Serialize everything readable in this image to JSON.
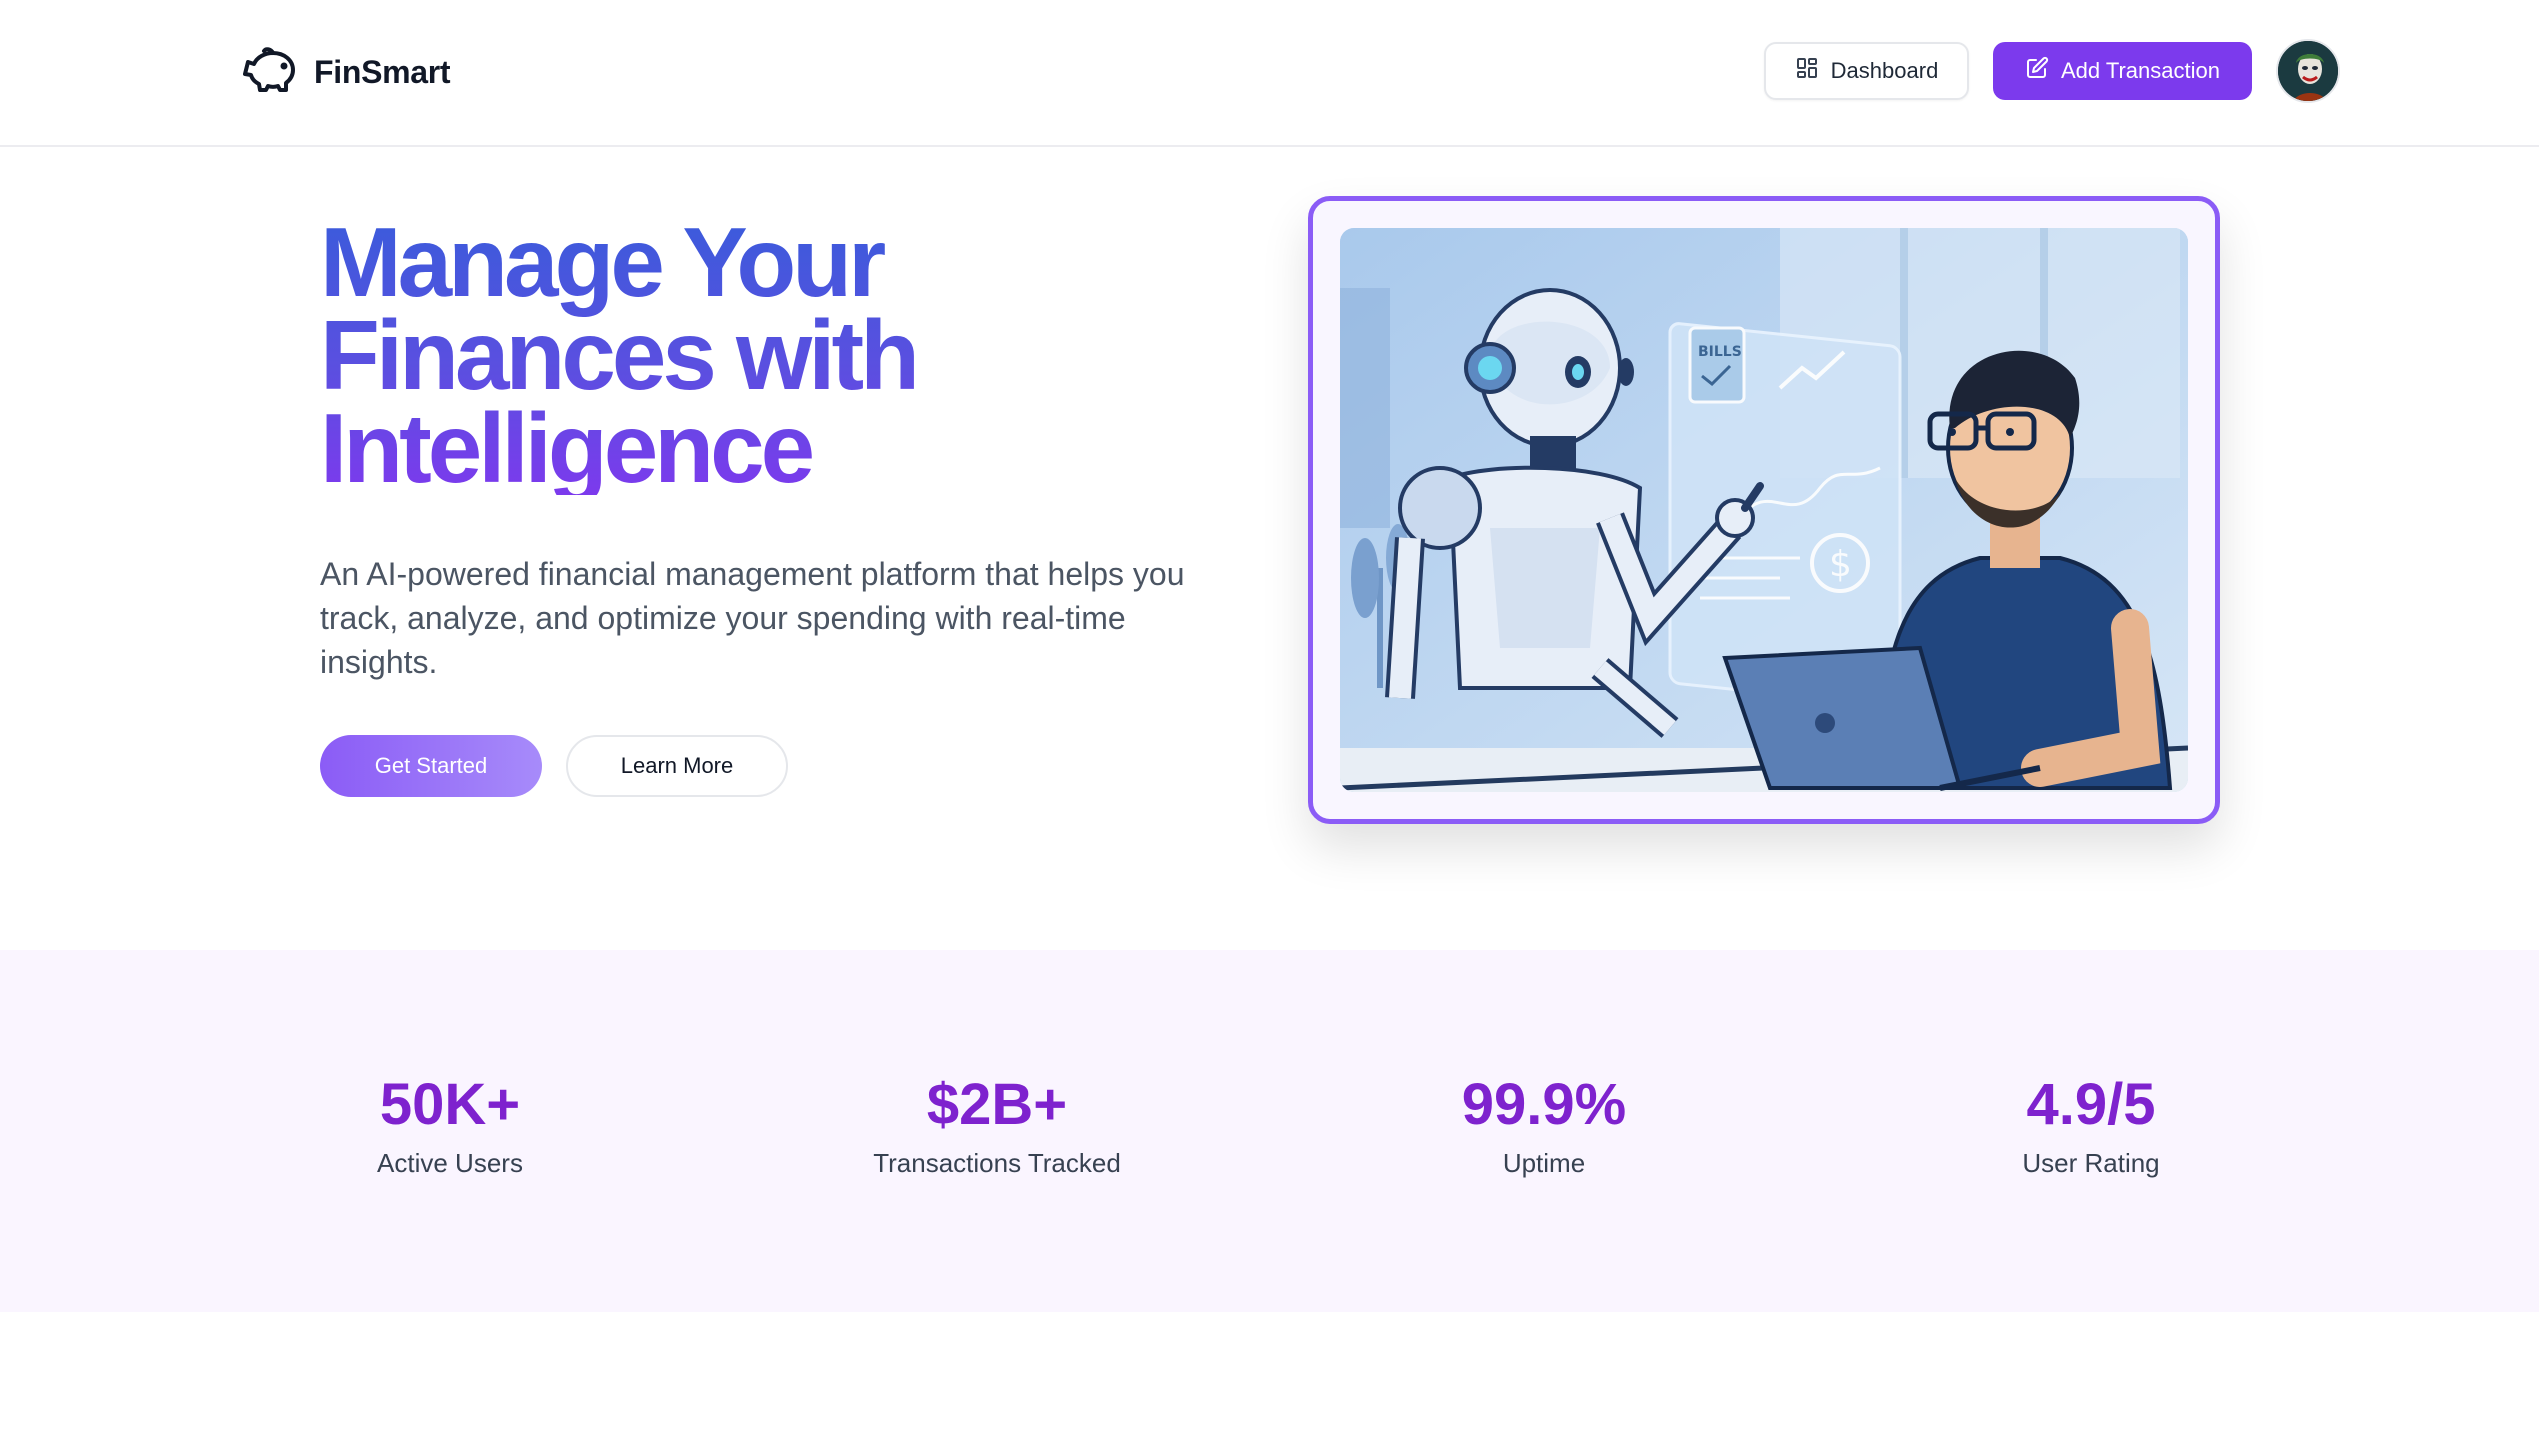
{
  "app": {
    "name": "FinSmart"
  },
  "header": {
    "dashboard_label": "Dashboard",
    "add_transaction_label": "Add Transaction"
  },
  "hero": {
    "title_lines": [
      "Manage Your",
      "Finances with",
      "Intelligence"
    ],
    "subtitle": "An AI-powered financial management platform that helps you track, analyze, and optimize your spending with real-time insights.",
    "primary_cta": "Get Started",
    "secondary_cta": "Learn More",
    "illustration": {
      "panel_card_label": "BILLS"
    }
  },
  "stats": [
    {
      "value": "50K+",
      "label": "Active Users"
    },
    {
      "value": "$2B+",
      "label": "Transactions Tracked"
    },
    {
      "value": "99.9%",
      "label": "Uptime"
    },
    {
      "value": "4.9/5",
      "label": "User Rating"
    }
  ],
  "colors": {
    "accent": "#7c3aed",
    "stat_value": "#7e22ce",
    "stats_bg": "#faf5ff",
    "title_gradient_start": "#3b5bdb",
    "title_gradient_end": "#7c3aed"
  },
  "icons": [
    "piggy-bank-icon",
    "dashboard-grid-icon",
    "edit-icon"
  ]
}
